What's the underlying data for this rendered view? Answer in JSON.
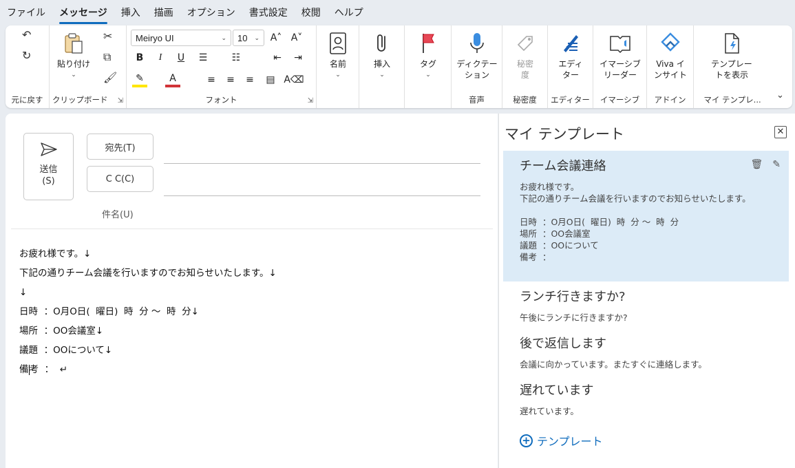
{
  "menu": [
    "ファイル",
    "メッセージ",
    "挿入",
    "描画",
    "オプション",
    "書式設定",
    "校閲",
    "ヘルプ"
  ],
  "active_menu": "メッセージ",
  "ribbon": {
    "undo_group": "元に戻す",
    "clipboard": {
      "paste": "貼り付け",
      "label": "クリップボード"
    },
    "font": {
      "face": "Meiryo UI",
      "size": "10",
      "label": "フォント"
    },
    "names": "名前",
    "insert": "挿入",
    "tag": "タグ",
    "dictation": {
      "line1": "ディクテー",
      "line2": "ション",
      "label": "音声"
    },
    "sensitivity": {
      "line1": "秘密",
      "line2": "度",
      "label": "秘密度"
    },
    "editor": {
      "line1": "エディ",
      "line2": "ター",
      "label": "エディター"
    },
    "immersive": {
      "line1": "イマーシブ",
      "line2": "リーダー",
      "label": "イマーシブ"
    },
    "viva": {
      "line1": "Viva イ",
      "line2": "ンサイト",
      "label": "アドイン"
    },
    "templates": {
      "line1": "テンプレー",
      "line2": "トを表示",
      "label": "マイ テンプレ..."
    }
  },
  "compose": {
    "send_line1": "送信",
    "send_line2": "(S)",
    "to_label": "宛先(T)",
    "cc_label": "C C(C)",
    "subject_label": "件名(U)",
    "body_lines": [
      "お疲れ様です。↓",
      "下記の通りチーム会議を行いますのでお知らせいたします。↓",
      "↓",
      "日時  ：O月O日(  曜日)  時  分 ～  時  分↓",
      "場所  ：OO会議室↓",
      "議題  ：OOについて↓"
    ],
    "last_line_a": "備",
    "last_line_b": "考  ：  ↵"
  },
  "pane": {
    "title": "マイ テンプレート",
    "close_glyph": "✕",
    "templates": [
      {
        "title": "チーム会議連絡",
        "body": "お疲れ様です。\n下記の通りチーム会議を行いますのでお知らせいたします。\n\n日時  ：O月O日(  曜日)  時  分 ～  時  分\n場所  ：OO会議室\n議題  ：OOについて\n備考  ："
      },
      {
        "title": "ランチ行きますか?",
        "body": "午後にランチに行きますか?"
      },
      {
        "title": "後で返信します",
        "body": "会議に向かっています。またすぐに連絡します。"
      },
      {
        "title": "遅れています",
        "body": "遅れています。"
      }
    ],
    "add_label": "テンプレート"
  },
  "colors": {
    "accent": "#0f6cbd",
    "selected": "#dcebf7"
  }
}
